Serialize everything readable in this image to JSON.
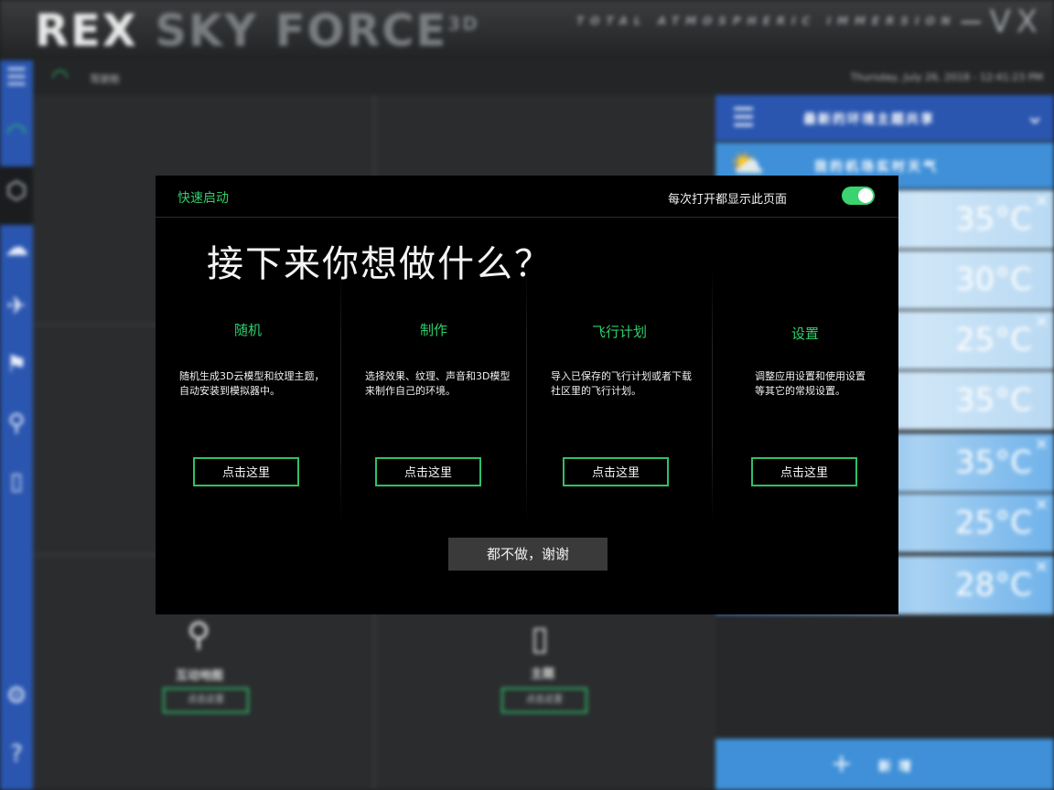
{
  "app": {
    "brand_main": "REX",
    "brand_sub": "SKY FORCE",
    "brand_suffix": "3D",
    "tagline": "TOTAL ATMOSPHERIC IMMERSION",
    "window_controls": "−VX"
  },
  "topbar": {
    "section_label": "驾驶舱",
    "datetime": "Thursday, July 26, 2018 - 12:41:23 PM"
  },
  "tiles": {
    "map_label": "互动地图",
    "map_button": "点击这里",
    "theme_label": "主题",
    "theme_button": "点击这里"
  },
  "right_panel": {
    "header": "最新的环境主题共享",
    "weather_title": "我的机场实时天气",
    "temps": [
      "35°C",
      "30°C",
      "25°C",
      "35°C",
      "35°C",
      "25°C",
      "28°C"
    ],
    "add_label": "新增"
  },
  "modal": {
    "title": "快速启动",
    "show_every_time": "每次打开都显示此页面",
    "toggle_on": true,
    "heading": "接下来你想做什么？",
    "columns": [
      {
        "title": "随机",
        "desc": "随机生成3D云模型和纹理主题，自动安装到模拟器中。",
        "button": "点击这里"
      },
      {
        "title": "制作",
        "desc": "选择效果、纹理、声音和3D模型来制作自己的环境。",
        "button": "点击这里"
      },
      {
        "title": "飞行计划",
        "desc": "导入已保存的飞行计划或者下载社区里的飞行计划。",
        "button": "点击这里"
      },
      {
        "title": "设置",
        "desc": "调整应用设置和使用设置等其它的常规设置。",
        "button": "点击这里"
      }
    ],
    "decline": "都不做，谢谢"
  },
  "colors": {
    "accent_green": "#2fd06a",
    "sidebar_blue": "#2a56b0",
    "panel_blue": "#3f90d8"
  }
}
